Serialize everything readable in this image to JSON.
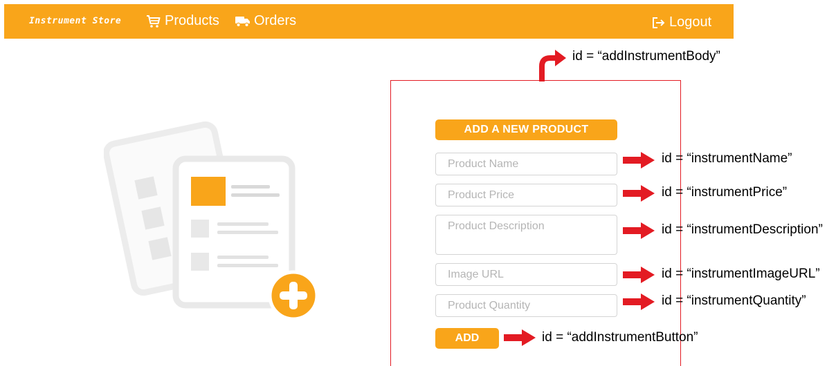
{
  "navbar": {
    "brand": "Instrument Store",
    "products_label": "Products",
    "orders_label": "Orders",
    "logout_label": "Logout"
  },
  "form": {
    "title": "ADD A NEW PRODUCT",
    "name_placeholder": "Product Name",
    "price_placeholder": "Product Price",
    "description_placeholder": "Product Description",
    "image_placeholder": "Image URL",
    "quantity_placeholder": "Product Quantity",
    "add_label": "ADD"
  },
  "annotations": {
    "body": "id = “addInstrumentBody”",
    "name": "id = “instrumentName”",
    "price": "id = “instrumentPrice”",
    "description": "id = “instrumentDescription”",
    "image": "id = “instrumentImageURL”",
    "quantity": "id = “instrumentQuantity”",
    "button": "id = “addInstrumentButton”"
  },
  "colors": {
    "brand": "#f9a51a",
    "annotation": "#e31b23",
    "illustration": "#ececec"
  },
  "icons": {
    "products": "cart-icon",
    "orders": "truck-icon",
    "logout": "logout-icon",
    "add": "plus-circle-icon"
  }
}
